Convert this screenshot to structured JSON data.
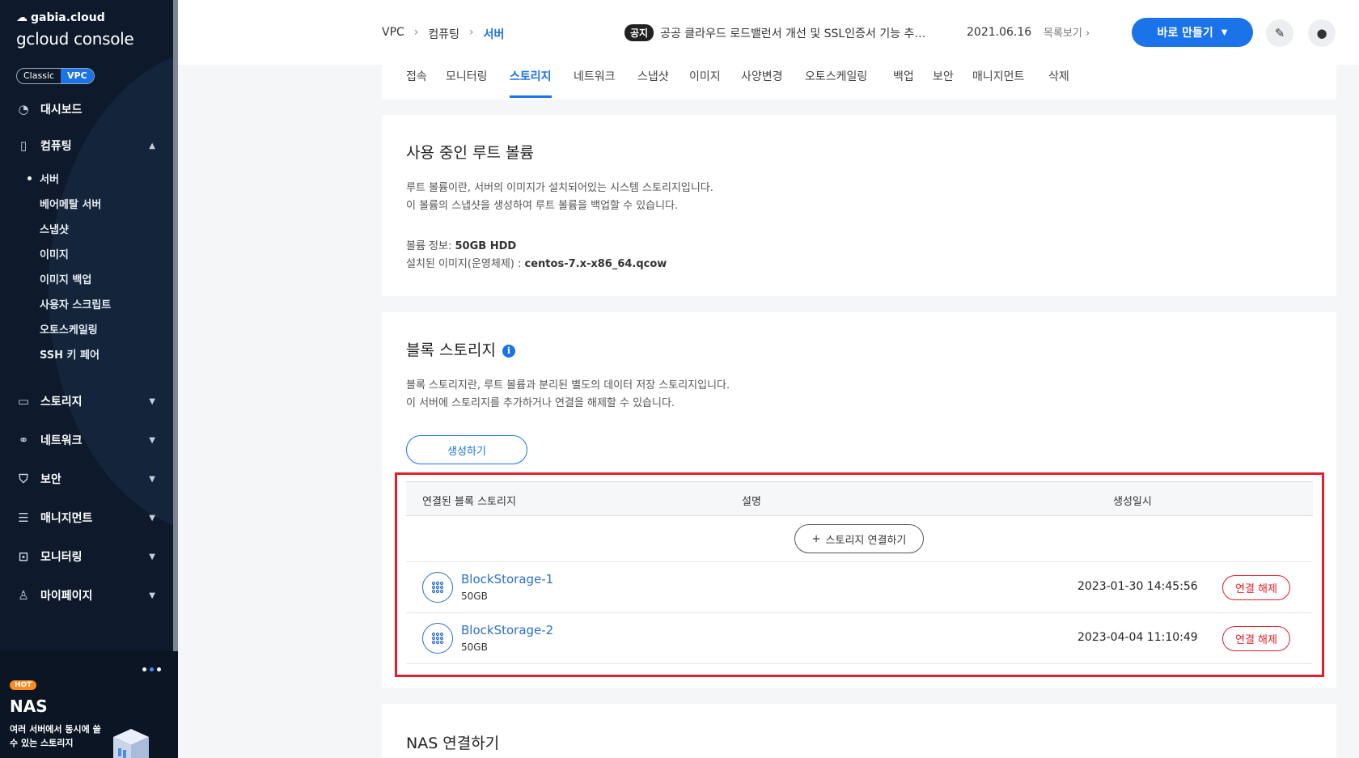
{
  "sidebar": {
    "brand_small": "gabia.cloud",
    "brand_big": "gcloud console",
    "mode_classic": "Classic",
    "mode_vpc": "VPC",
    "dashboard": "대시보드",
    "computing": "컴퓨팅",
    "computing_items": [
      "서버",
      "베어메탈 서버",
      "스냅샷",
      "이미지",
      "이미지 백업",
      "사용자 스크립트",
      "오토스케일링",
      "SSH 키 페어"
    ],
    "storage": "스토리지",
    "network": "네트워크",
    "security": "보안",
    "management": "매니지먼트",
    "monitoring": "모니터링",
    "mypage": "마이페이지",
    "promo": {
      "badge": "HOT",
      "title": "NAS",
      "desc": "여러 서버에서 동시에 쓸 수 있는 스토리지"
    }
  },
  "topbar": {
    "breadcrumb": [
      "VPC",
      "컴퓨팅",
      "서버"
    ],
    "notice_tag": "공지",
    "notice_text": "공공 클라우드 로드밸런서 개선 및 SSL인증서 기능 추…",
    "notice_date": "2021.06.16",
    "notice_more": "목록보기",
    "make_button": "바로 만들기"
  },
  "tabs": [
    "접속",
    "모니터링",
    "스토리지",
    "네트워크",
    "스냅샷",
    "이미지",
    "사양변경",
    "오토스케일링",
    "백업",
    "보안",
    "매니지먼트",
    "삭제"
  ],
  "active_tab": "스토리지",
  "root_volume": {
    "title": "사용 중인 루트 볼륨",
    "desc1": "루트 볼륨이란, 서버의 이미지가 설치되어있는 시스템 스토리지입니다.",
    "desc2": "이 볼륨의 스냅샷을 생성하여 루트 볼륨을 백업할 수 있습니다.",
    "info_label": "볼륨 정보:",
    "info_value": "50GB HDD",
    "image_label": "설치된 이미지(운영체제) :",
    "image_value": "centos-7.x-x86_64.qcow"
  },
  "block_storage": {
    "title": "블록 스토리지",
    "info_icon": "i",
    "desc1": "블록 스토리지란, 루트 볼륨과 분리된 별도의 데이터 저장 스토리지입니다.",
    "desc2": "이 서버에 스토리지를 추가하거나 연결을 해제할 수 있습니다.",
    "create_button": "생성하기",
    "columns": [
      "연결된 블록 스토리지",
      "설명",
      "생성일시"
    ],
    "connect_button": "스토리지 연결하기",
    "rows": [
      {
        "name": "BlockStorage-1",
        "size": "50GB",
        "created": "2023-01-30 14:45:56",
        "action": "연결 해제"
      },
      {
        "name": "BlockStorage-2",
        "size": "50GB",
        "created": "2023-04-04 11:10:49",
        "action": "연결 해제"
      }
    ]
  },
  "nas": {
    "title": "NAS 연결하기"
  }
}
